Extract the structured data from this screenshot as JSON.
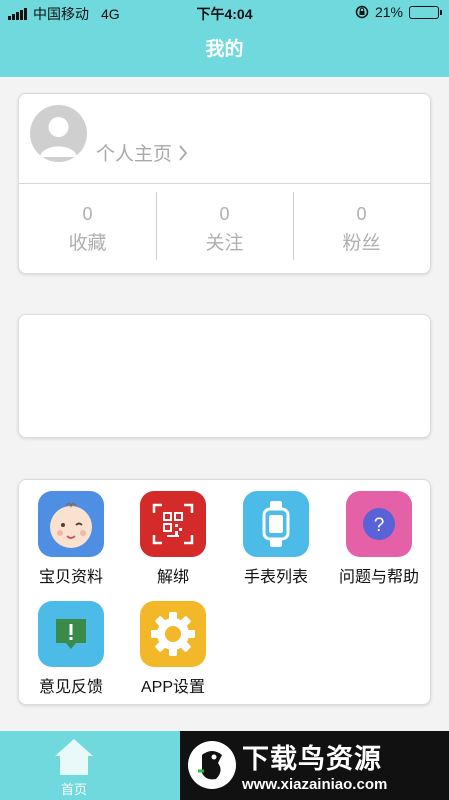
{
  "status": {
    "carrier": "中国移动",
    "network": "4G",
    "time": "下午4:04",
    "battery": "21%",
    "battery_level": 0.21
  },
  "header": {
    "title": "我的"
  },
  "profile": {
    "link_label": "个人主页",
    "stats": [
      {
        "count": "0",
        "label": "收藏"
      },
      {
        "count": "0",
        "label": "关注"
      },
      {
        "count": "0",
        "label": "粉丝"
      }
    ]
  },
  "menu": {
    "items": [
      {
        "label": "宝贝资料",
        "icon": "baby-face-icon",
        "color": "#4f8fe3"
      },
      {
        "label": "解绑",
        "icon": "qr-unbind-icon",
        "color": "#d42a2a"
      },
      {
        "label": "手表列表",
        "icon": "watch-icon",
        "color": "#4dbbe8"
      },
      {
        "label": "问题与帮助",
        "icon": "help-icon",
        "color": "#e461a8"
      },
      {
        "label": "意见反馈",
        "icon": "feedback-icon",
        "color": "#4dbbe8"
      },
      {
        "label": "APP设置",
        "icon": "gear-icon",
        "color": "#f2b82a"
      }
    ]
  },
  "tabbar": {
    "home_label": "首页"
  },
  "watermark": {
    "title": "下载鸟资源",
    "url": "www.xiazainiao.com"
  },
  "colors": {
    "theme": "#6fd9de",
    "card_border": "#dcdcdc",
    "muted_text": "#a9a9a9"
  }
}
